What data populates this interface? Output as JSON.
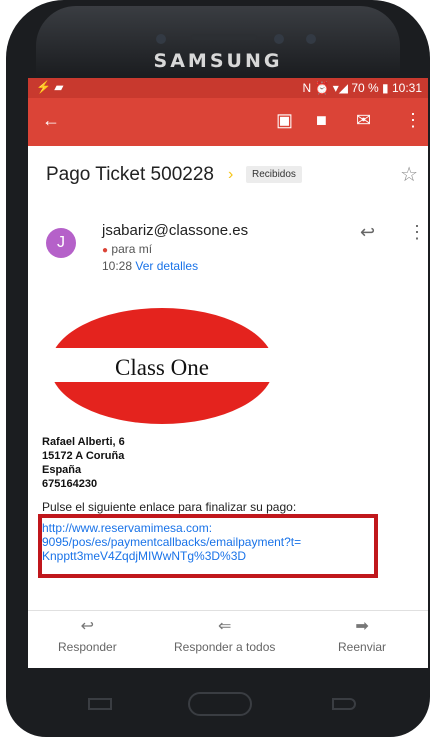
{
  "device": {
    "brand": "SAMSUNG"
  },
  "status_bar": {
    "battery": "70 %",
    "time": "10:31"
  },
  "toolbar": {
    "back_icon": "arrow-left-icon",
    "archive_icon": "archive-icon",
    "delete_icon": "trash-icon",
    "mark_unread_icon": "envelope-icon",
    "more_icon": "more-vert-icon"
  },
  "message": {
    "subject": "Pago Ticket 500228",
    "label": "Recibidos",
    "sender_initial": "J",
    "sender": "jsabariz@classone.es",
    "recipient": "para mí",
    "time": "10:28",
    "details_link": "Ver detalles"
  },
  "body": {
    "logo_text": "Class One",
    "address_lines": [
      "Rafael Alberti, 6",
      "15172 A Coruña",
      "España",
      "675164230"
    ],
    "instruction": "Pulse el siguiente enlace para finalizar su pago:",
    "payment_link_lines": [
      "http://www.reservamimesa.com:",
      "9095/pos/es/paymentcallbacks/emailpayment?t=",
      "Knpptt3meV4ZqdjMIWwNTg%3D%3D"
    ]
  },
  "actions": {
    "reply": "Responder",
    "reply_all": "Responder a todos",
    "forward": "Reenviar"
  },
  "colors": {
    "accent": "#db4437",
    "highlight": "#c0171c",
    "link": "#1a73e8"
  }
}
